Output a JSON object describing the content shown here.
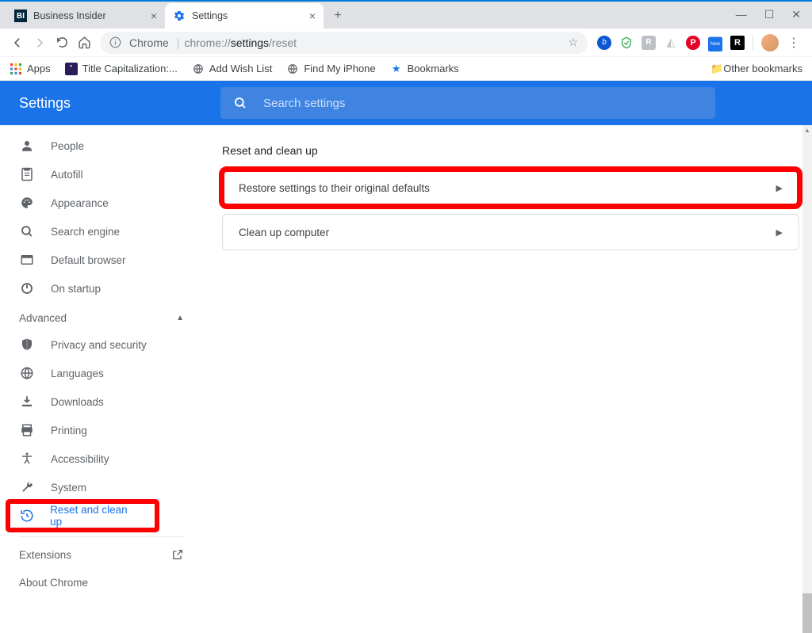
{
  "window": {
    "tabs": [
      {
        "title": "Business Insider",
        "favicon": "BI"
      },
      {
        "title": "Settings",
        "favicon": "gear"
      }
    ]
  },
  "toolbar": {
    "chrome_label": "Chrome",
    "url_prefix": "chrome://",
    "url_bold": "settings",
    "url_suffix": "/reset"
  },
  "bookmarks": {
    "apps": "Apps",
    "items": [
      "Title Capitalization:...",
      "Add Wish List",
      "Find My iPhone",
      "Bookmarks"
    ],
    "other": "Other bookmarks"
  },
  "settings": {
    "title": "Settings",
    "search_placeholder": "Search settings"
  },
  "sidebar": {
    "basic": [
      {
        "label": "People",
        "icon": "person"
      },
      {
        "label": "Autofill",
        "icon": "autofill"
      },
      {
        "label": "Appearance",
        "icon": "palette"
      },
      {
        "label": "Search engine",
        "icon": "search"
      },
      {
        "label": "Default browser",
        "icon": "browser"
      },
      {
        "label": "On startup",
        "icon": "power"
      }
    ],
    "advanced_label": "Advanced",
    "advanced": [
      {
        "label": "Privacy and security",
        "icon": "shield"
      },
      {
        "label": "Languages",
        "icon": "globe"
      },
      {
        "label": "Downloads",
        "icon": "download"
      },
      {
        "label": "Printing",
        "icon": "print"
      },
      {
        "label": "Accessibility",
        "icon": "accessibility"
      },
      {
        "label": "System",
        "icon": "wrench"
      },
      {
        "label": "Reset and clean up",
        "icon": "restore"
      }
    ],
    "extensions": "Extensions",
    "about": "About Chrome"
  },
  "main": {
    "heading": "Reset and clean up",
    "rows": [
      "Restore settings to their original defaults",
      "Clean up computer"
    ]
  }
}
